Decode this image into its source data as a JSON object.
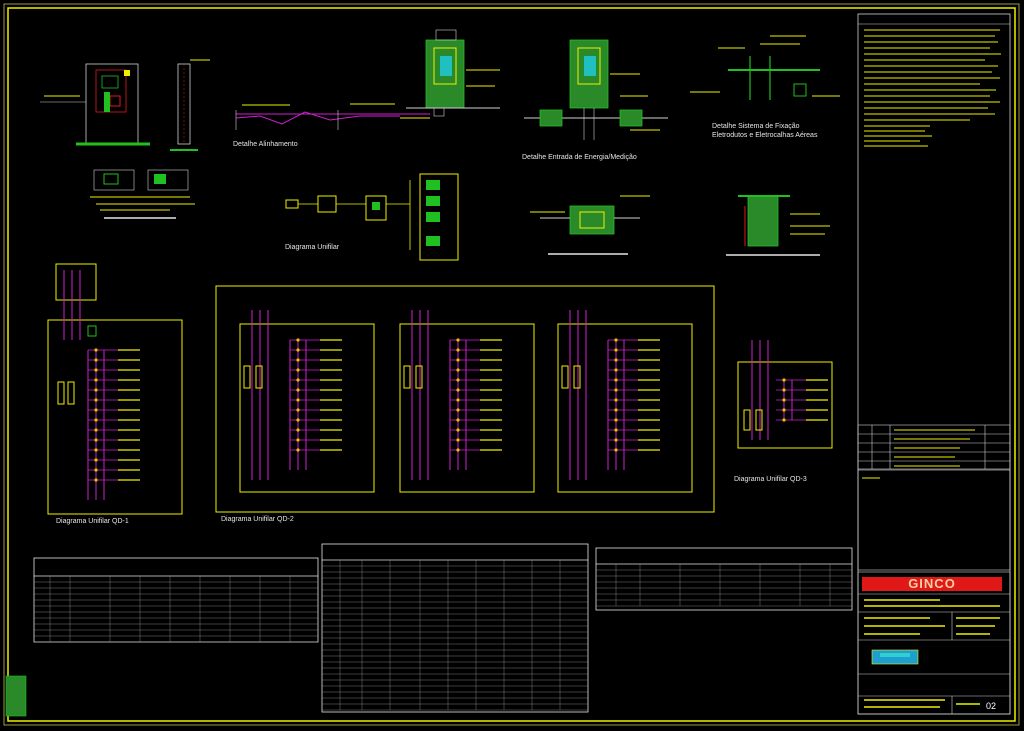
{
  "colors": {
    "background": "#000000",
    "frame": "#f0f000",
    "magenta": "#d020d0",
    "green": "#20c020",
    "red": "#e01818",
    "cyan": "#20c0c0",
    "white": "#ffffff"
  },
  "captions": {
    "alinhamento": "Detalhe Alinhamento",
    "entrada": "Detalhe Entrada de Energia/Medição",
    "fixacao_1": "Detalhe Sistema de Fixação",
    "fixacao_2": "Eletrodutos e Eletrocalhas Aéreas",
    "unifilar": "Diagrama Unifilar",
    "qd1": "Diagrama Unifilar QD-1",
    "qd2": "Diagrama Unifilar QD-2",
    "qd3": "Diagrama Unifilar QD-3"
  },
  "title_block": {
    "brand": "GINCO",
    "sheet_number": "02"
  }
}
